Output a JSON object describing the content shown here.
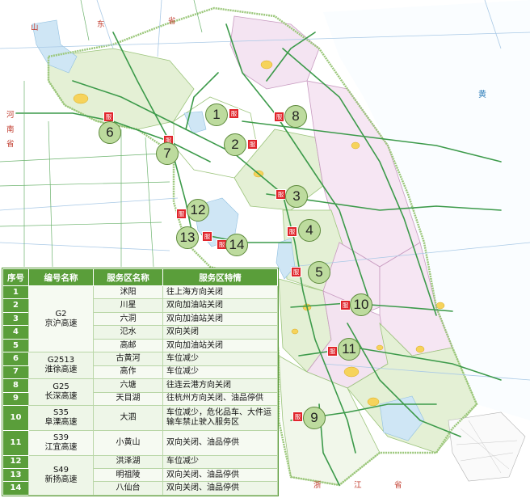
{
  "region_labels": [
    {
      "text": "山",
      "class": ""
    },
    {
      "text": "东",
      "class": ""
    },
    {
      "text": "省",
      "class": ""
    },
    {
      "text": "河",
      "class": ""
    },
    {
      "text": "南",
      "class": ""
    },
    {
      "text": "省",
      "class": ""
    },
    {
      "text": "黄",
      "class": "sea"
    },
    {
      "text": "浙",
      "class": ""
    },
    {
      "text": "江",
      "class": ""
    },
    {
      "text": "省",
      "class": ""
    }
  ],
  "service_badge": "服",
  "markers": [
    "1",
    "2",
    "3",
    "4",
    "5",
    "6",
    "7",
    "8",
    "9",
    "10",
    "11",
    "12",
    "13",
    "14"
  ],
  "table": {
    "headers": [
      "序号",
      "编号名称",
      "服务区名称",
      "服务区特情"
    ],
    "groups": [
      {
        "code": "G2",
        "name": "京沪高速",
        "rows": [
          {
            "num": "1",
            "area": "沭阳",
            "feature": "往上海方向关闭"
          },
          {
            "num": "2",
            "area": "川星",
            "feature": "双向加油站关闭"
          },
          {
            "num": "3",
            "area": "六洞",
            "feature": "双向加油站关闭"
          },
          {
            "num": "4",
            "area": "氾水",
            "feature": "双向关闭"
          },
          {
            "num": "5",
            "area": "高邮",
            "feature": "双向加油站关闭"
          }
        ]
      },
      {
        "code": "G2513",
        "name": "淮徐高速",
        "rows": [
          {
            "num": "6",
            "area": "古黄河",
            "feature": "车位减少"
          },
          {
            "num": "7",
            "area": "高作",
            "feature": "车位减少"
          }
        ]
      },
      {
        "code": "G25",
        "name": "长深高速",
        "rows": [
          {
            "num": "8",
            "area": "六塘",
            "feature": "往连云港方向关闭"
          },
          {
            "num": "9",
            "area": "天目湖",
            "feature": "往杭州方向关闭、油品停供"
          }
        ]
      },
      {
        "code": "S35",
        "name": "阜溧高速",
        "rows": [
          {
            "num": "10",
            "area": "大泗",
            "feature": "车位减少，危化品车、大件运输车禁止驶入服务区"
          }
        ]
      },
      {
        "code": "S39",
        "name": "江宜高速",
        "rows": [
          {
            "num": "11",
            "area": "小黄山",
            "feature": "双向关闭、油品停供"
          }
        ]
      },
      {
        "code": "S49",
        "name": "新扬高速",
        "rows": [
          {
            "num": "12",
            "area": "洪泽湖",
            "feature": "车位减少"
          },
          {
            "num": "13",
            "area": "明祖陵",
            "feature": "双向关闭、油品停供"
          },
          {
            "num": "14",
            "area": "八仙台",
            "feature": "双向关闭、油品停供"
          }
        ]
      }
    ]
  }
}
